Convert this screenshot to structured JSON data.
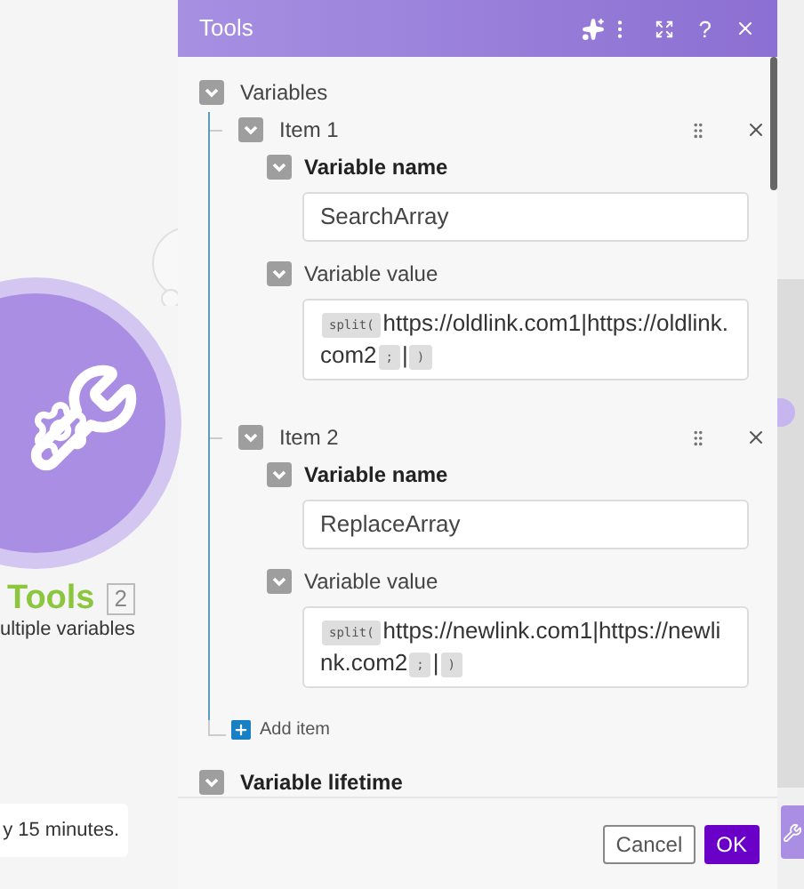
{
  "canvas": {
    "module_title": "Tools",
    "module_badge": "2",
    "module_subtitle": "ultiple variables",
    "toast": "y 15 minutes."
  },
  "dialog": {
    "title": "Tools",
    "help": "?",
    "variables_label": "Variables",
    "items": [
      {
        "label": "Item 1",
        "name_label": "Variable name",
        "name_value": "SearchArray",
        "value_label": "Variable value",
        "value": [
          {
            "kind": "chip",
            "text": "split("
          },
          {
            "kind": "text",
            "text": "https://oldlink.com1|https://oldlink.com2"
          },
          {
            "kind": "chip",
            "text": ";"
          },
          {
            "kind": "text",
            "text": "|"
          },
          {
            "kind": "chip",
            "text": ")"
          }
        ]
      },
      {
        "label": "Item 2",
        "name_label": "Variable name",
        "name_value": "ReplaceArray",
        "value_label": "Variable value",
        "value": [
          {
            "kind": "chip",
            "text": "split("
          },
          {
            "kind": "text",
            "text": "https://newlink.com1|https://newlink.com2"
          },
          {
            "kind": "chip",
            "text": ";"
          },
          {
            "kind": "text",
            "text": "|"
          },
          {
            "kind": "chip",
            "text": ")"
          }
        ]
      }
    ],
    "add_item": "Add item",
    "lifetime_label": "Variable lifetime",
    "buttons": [
      {
        "kind": "secondary",
        "label": "Cancel"
      },
      {
        "kind": "primary",
        "label": "OK"
      }
    ]
  }
}
